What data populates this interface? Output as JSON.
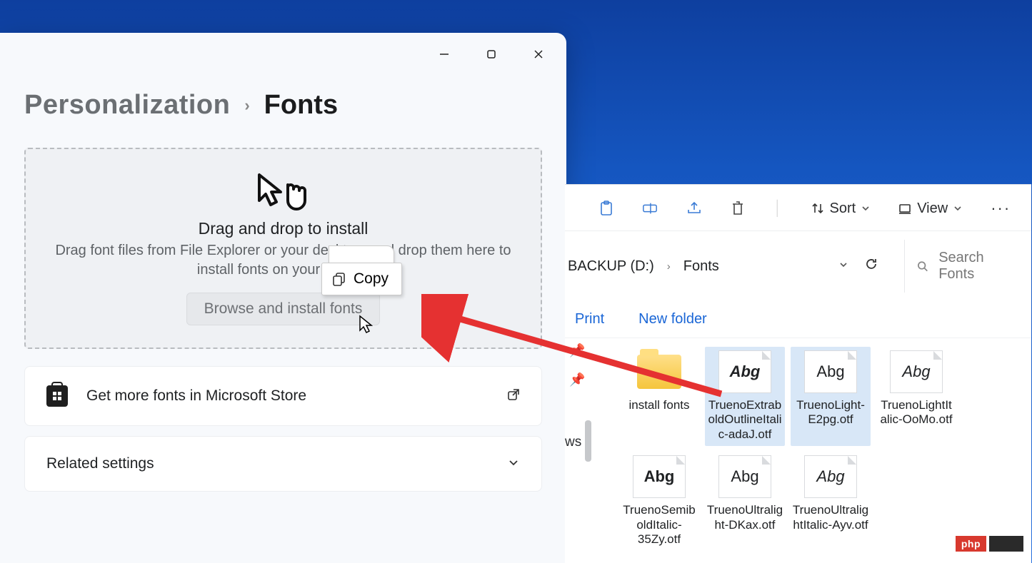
{
  "settings": {
    "breadcrumb_parent": "Personalization",
    "breadcrumb_current": "Fonts",
    "dropzone": {
      "title": "Drag and drop to install",
      "subtitle": "Drag font files from File Explorer or your desktop, and drop them here to install fonts on your device.",
      "browse_label": "Browse and install fonts"
    },
    "store_link": "Get more fonts in Microsoft Store",
    "related_settings": "Related settings"
  },
  "drag_tooltip": {
    "label": "Copy"
  },
  "explorer": {
    "toolbar": {
      "sort": "Sort",
      "view": "View"
    },
    "path": {
      "drive": "BACKUP (D:)",
      "folder": "Fonts"
    },
    "search_placeholder": "Search Fonts",
    "actions": {
      "print": "Print",
      "new_folder": "New folder"
    },
    "side_fragment": "ws",
    "files": [
      {
        "name": "install fonts",
        "type": "folder",
        "selected": false
      },
      {
        "name": "TruenoExtraboldOutlineItalic-adaJ.otf",
        "type": "font",
        "style": "bolditalic",
        "selected": true
      },
      {
        "name": "TruenoLight-E2pg.otf",
        "type": "font",
        "style": "",
        "selected": true
      },
      {
        "name": "TruenoLightItalic-OoMo.otf",
        "type": "font",
        "style": "italic",
        "selected": false
      },
      {
        "name": "TruenoSemiboldItalic-35Zy.otf",
        "type": "font",
        "style": "bold",
        "selected": false
      },
      {
        "name": "TruenoUltralight-DKax.otf",
        "type": "font",
        "style": "",
        "selected": false
      },
      {
        "name": "TruenoUltralightItalic-Ayv.otf",
        "type": "font",
        "style": "italic",
        "selected": false
      }
    ],
    "font_thumb_text": "Abg"
  },
  "watermark": {
    "text": "php"
  }
}
